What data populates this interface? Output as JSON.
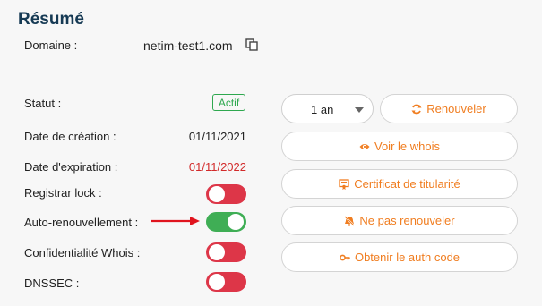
{
  "summary": {
    "title": "Résumé",
    "domain_label": "Domaine :",
    "domain_value": "netim-test1.com"
  },
  "rows": {
    "status": {
      "label": "Statut :",
      "badge": "Actif"
    },
    "created": {
      "label": "Date de création :",
      "value": "01/11/2021"
    },
    "expires": {
      "label": "Date d'expiration :",
      "value": "01/11/2022"
    },
    "registrar_lock": {
      "label": "Registrar lock :",
      "enabled": false
    },
    "auto_renew": {
      "label": "Auto-renouvellement :",
      "enabled": true
    },
    "whois_privacy": {
      "label": "Confidentialité Whois :",
      "enabled": false
    },
    "dnssec": {
      "label": "DNSSEC :",
      "enabled": false
    }
  },
  "actions": {
    "duration_select": "1 an",
    "renew": "Renouveler",
    "whois": "Voir le whois",
    "certificate": "Certificat de titularité",
    "no_renew": "Ne pas renouveler",
    "auth_code": "Obtenir le auth code"
  },
  "colors": {
    "accent": "#f07d20",
    "toggle_on": "#3fae55",
    "toggle_off": "#dd3648",
    "title": "#163a54",
    "expired_date": "#d22a2a",
    "arrow": "#e0141e"
  }
}
